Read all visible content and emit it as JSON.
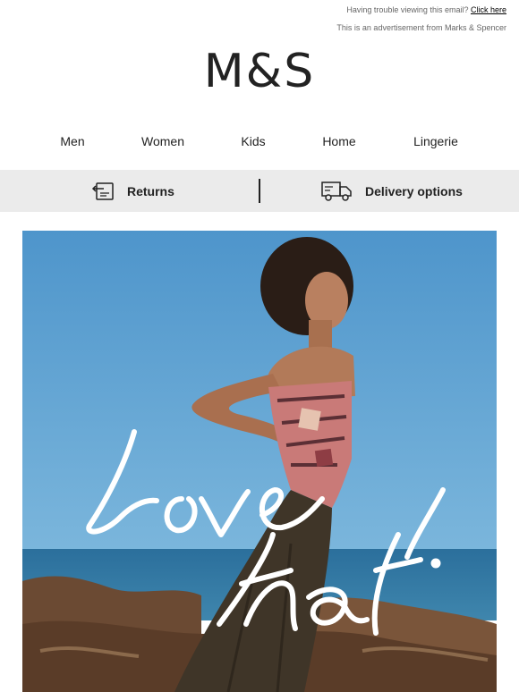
{
  "preheader": {
    "trouble_text": "Having trouble viewing this email?",
    "click_here": "Click here",
    "ad_text": "This is an advertisement from Marks & Spencer"
  },
  "brand": {
    "logo_text": "M&S"
  },
  "nav": {
    "items": [
      {
        "label": "Men"
      },
      {
        "label": "Women"
      },
      {
        "label": "Kids"
      },
      {
        "label": "Home"
      },
      {
        "label": "Lingerie"
      }
    ]
  },
  "services": {
    "returns": {
      "label": "Returns",
      "icon": "returns-icon"
    },
    "delivery": {
      "label": "Delivery options",
      "icon": "delivery-van-icon"
    }
  },
  "hero": {
    "script_text": "Love that.",
    "colors": {
      "sky": "#5d9fd1",
      "sea": "#2f6e98",
      "rocks": "#6b4a33",
      "skirt": "#3f3528",
      "top": "#c97a78"
    }
  },
  "colors": {
    "service_bar": "#ebebeb",
    "text": "#222222"
  }
}
